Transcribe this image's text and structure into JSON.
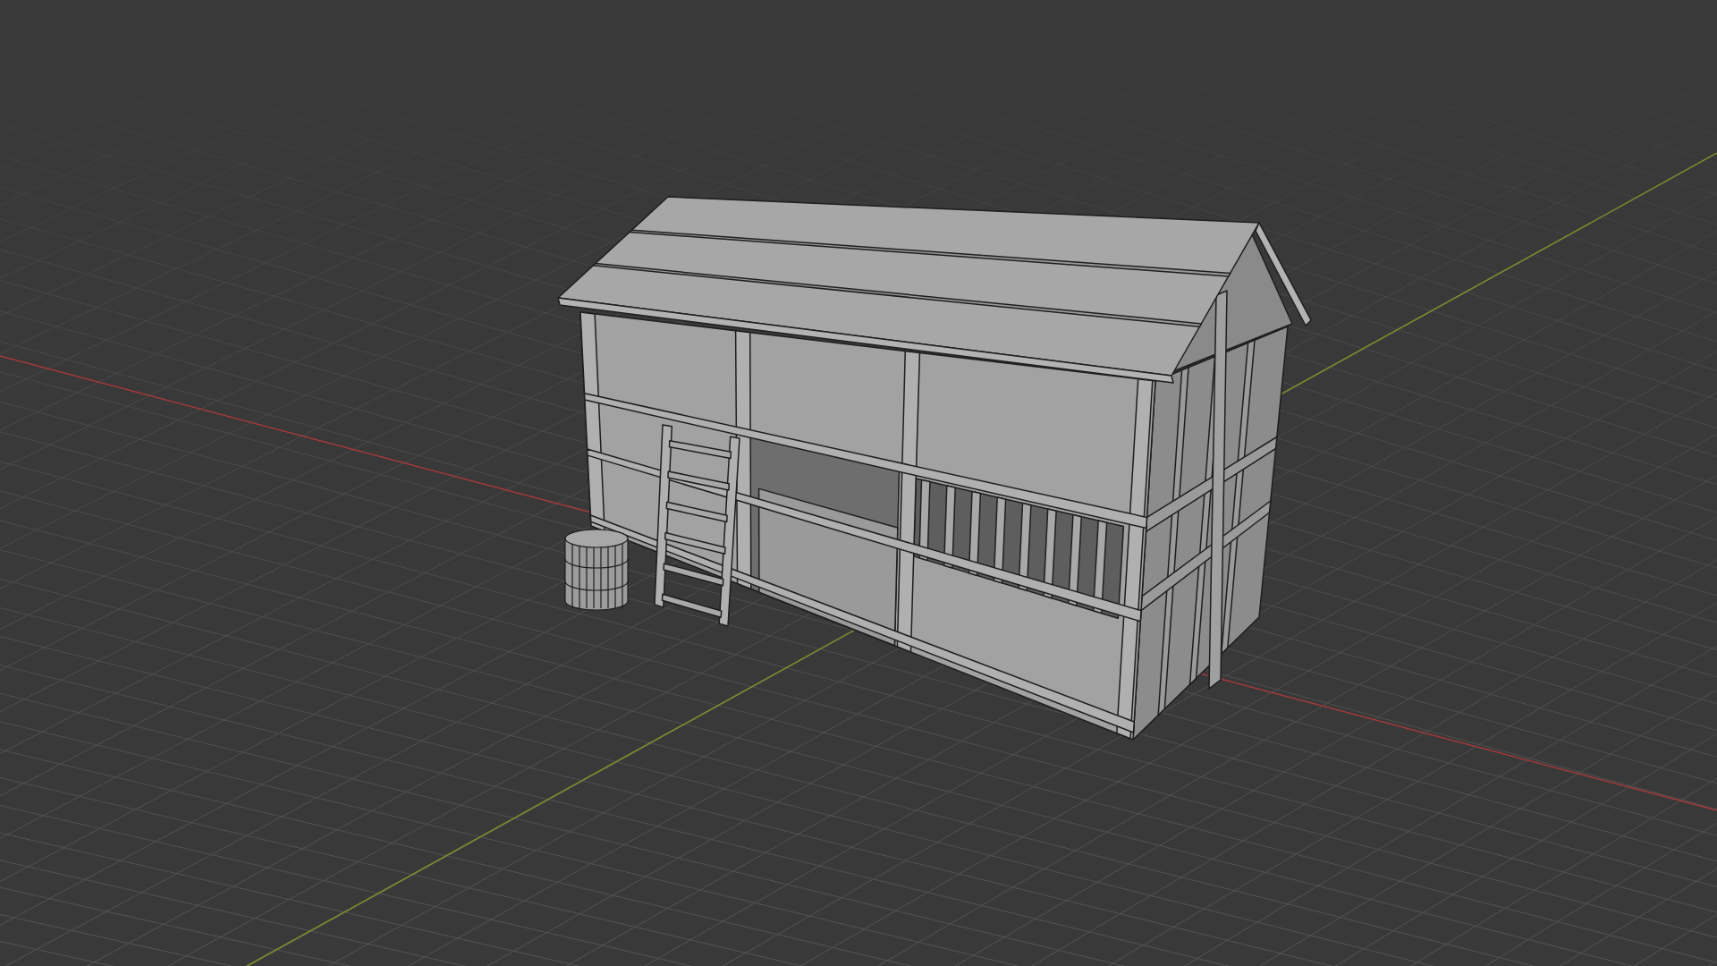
{
  "viewport": {
    "kind": "perspective",
    "floor_grid": true,
    "objects": [
      {
        "kind": "house"
      },
      {
        "kind": "barrel"
      }
    ]
  }
}
